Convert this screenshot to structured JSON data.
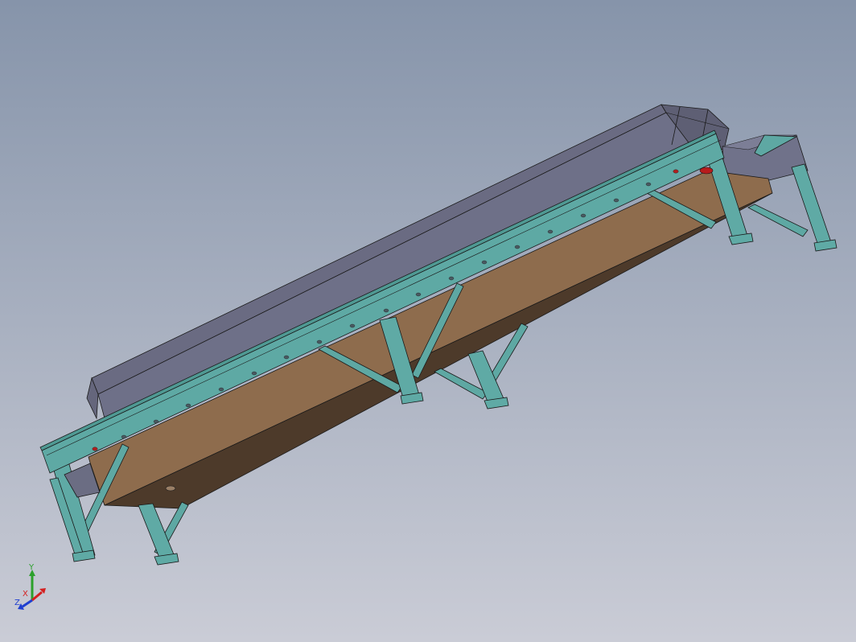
{
  "triad": {
    "x_label": "X",
    "y_label": "Y",
    "z_label": "Z"
  },
  "colors": {
    "background_top": "#8795ab",
    "background_bottom": "#c9ccd6",
    "frame_teal": "#5fa9a5",
    "cover_grey": "#6f7086",
    "pan_brown": "#8f6d4e",
    "pan_dark": "#4f3b2b",
    "edge": "#1a1a1a",
    "x_axis": "#d42020",
    "y_axis": "#2ca02c",
    "z_axis": "#1f3fd0"
  }
}
